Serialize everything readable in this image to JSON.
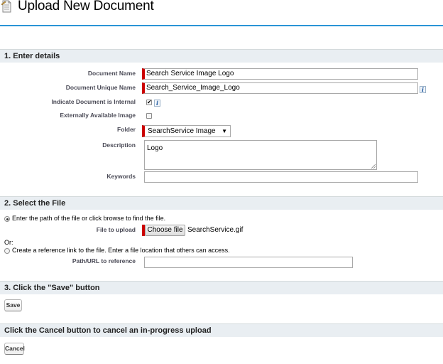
{
  "header": {
    "title": "Upload New Document"
  },
  "sections": {
    "details": "1. Enter details",
    "file": "2. Select the File",
    "save": "3. Click the \"Save\" button",
    "cancel": "Click the Cancel button to cancel an in-progress upload"
  },
  "details": {
    "document_name_label": "Document Name",
    "document_name_value": "Search Service Image Logo",
    "unique_name_label": "Document Unique Name",
    "unique_name_value": "Search_Service_Image_Logo",
    "internal_label": "Indicate Document is Internal",
    "internal_checked": true,
    "external_label": "Externally Available Image",
    "external_checked": false,
    "folder_label": "Folder",
    "folder_value": "SearchService Image",
    "description_label": "Description",
    "description_value": "Logo",
    "keywords_label": "Keywords",
    "keywords_value": ""
  },
  "file": {
    "option_browse": "Enter the path of the file or click browse to find the file.",
    "file_label": "File to upload",
    "choose_button": "Choose file",
    "chosen_file": "SearchService.gif",
    "or_text": "Or:",
    "option_reference": "Create a reference link to the file. Enter a file location that others can access.",
    "path_label": "Path/URL to reference",
    "path_value": ""
  },
  "buttons": {
    "save": "Save",
    "cancel": "Cancel"
  },
  "colors": {
    "required": "#c00000",
    "accent": "#2a94d6",
    "section_bg": "#e9eef2"
  }
}
